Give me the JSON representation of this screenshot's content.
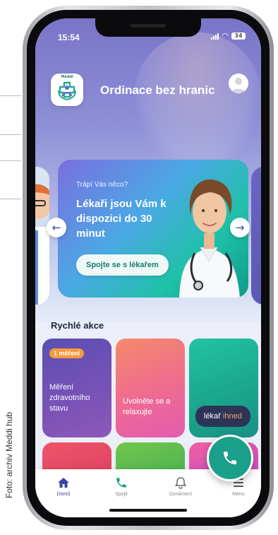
{
  "caption": "Foto: archiv Meddi hub",
  "status_bar": {
    "time": "15:54",
    "battery": "34"
  },
  "header": {
    "logo_text": "Meddi",
    "title": "Ordinace bez hranic"
  },
  "banner": {
    "subtitle": "Trápí Vás něco?",
    "headline": "Lékaři jsou Vám k dispozici do 30 minut",
    "cta_label": "Spojte se s lékařem"
  },
  "quick_actions": {
    "title": "Rychlé akce",
    "tiles": [
      {
        "badge": "1 měření",
        "label": "Měření zdravotního stavu"
      },
      {
        "label": "Uvolněte se a relaxujte"
      }
    ]
  },
  "doctor_chip": {
    "prefix": "lékař",
    "highlight": "ihned"
  },
  "nav": {
    "items": [
      {
        "label": "Domů",
        "icon": "home-icon"
      },
      {
        "label": "Spojit",
        "icon": "phone-icon"
      },
      {
        "label": "Oznámení",
        "icon": "bell-icon"
      },
      {
        "label": "Menu",
        "icon": "menu-icon"
      }
    ]
  },
  "colors": {
    "brand_teal": "#1aa08a",
    "nav_active": "#3a45a8",
    "badge_orange": "#f59a3a",
    "chip_dark": "#2d3458"
  }
}
